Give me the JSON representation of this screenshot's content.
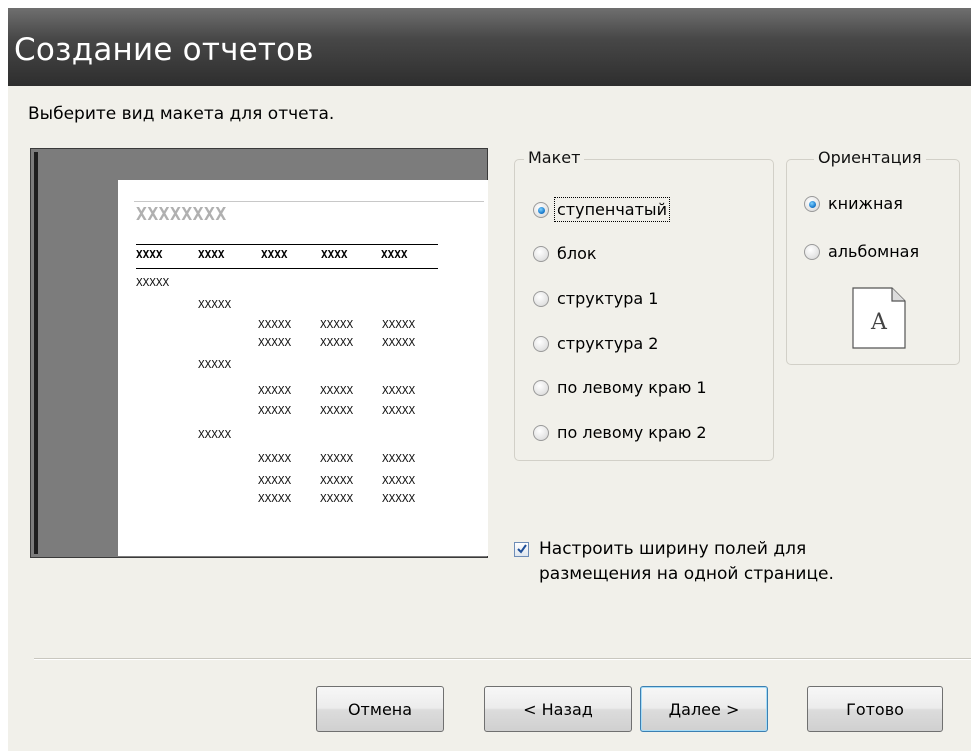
{
  "window": {
    "title": "Создание отчетов"
  },
  "prompt": "Выберите вид макета для отчета.",
  "preview": {
    "title": "XXXXXXXX",
    "header_cells": [
      "XXXX",
      "XXXX",
      "XXXX",
      "XXXX",
      "XXXX"
    ],
    "group1": "XXXXX",
    "group2": "XXXXX",
    "detail": "XXXXX"
  },
  "layout_group": {
    "legend": "Макет",
    "options": [
      {
        "label": "ступенчатый",
        "checked": true
      },
      {
        "label": "блок",
        "checked": false
      },
      {
        "label": "структура 1",
        "checked": false
      },
      {
        "label": "структура 2",
        "checked": false
      },
      {
        "label": "по левому краю 1",
        "checked": false
      },
      {
        "label": "по левому краю 2",
        "checked": false
      }
    ]
  },
  "orientation_group": {
    "legend": "Ориентация",
    "options": [
      {
        "label": "книжная",
        "checked": true
      },
      {
        "label": "альбомная",
        "checked": false
      }
    ],
    "icon_letter": "A",
    "icon": "portrait-page-icon"
  },
  "fit_checkbox": {
    "checked": true,
    "line1": "Настроить ширину полей для",
    "line2": "размещения на одной странице."
  },
  "buttons": {
    "cancel": "Отмена",
    "back": "< Назад",
    "next": "Далее >",
    "finish": "Готово"
  },
  "colors": {
    "accent": "#1e7fd0",
    "titlebar": "#474747"
  }
}
